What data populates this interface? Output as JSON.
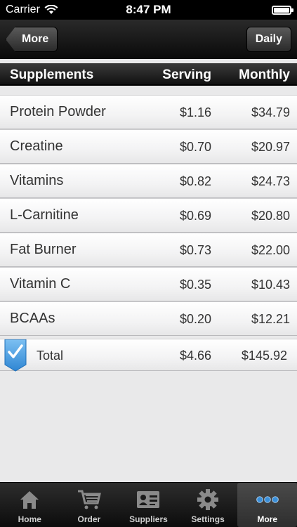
{
  "status_bar": {
    "carrier": "Carrier",
    "time": "8:47 PM"
  },
  "nav_bar": {
    "back_label": "More",
    "right_label": "Daily"
  },
  "table": {
    "headers": {
      "name": "Supplements",
      "serving": "Serving",
      "monthly": "Monthly"
    },
    "rows": [
      {
        "name": "Protein Powder",
        "serving": "$1.16",
        "monthly": "$34.79"
      },
      {
        "name": "Creatine",
        "serving": "$0.70",
        "monthly": "$20.97"
      },
      {
        "name": "Vitamins",
        "serving": "$0.82",
        "monthly": "$24.73"
      },
      {
        "name": "L-Carnitine",
        "serving": "$0.69",
        "monthly": "$20.80"
      },
      {
        "name": "Fat Burner",
        "serving": "$0.73",
        "monthly": "$22.00"
      },
      {
        "name": "Vitamin C",
        "serving": "$0.35",
        "monthly": "$10.43"
      },
      {
        "name": "BCAAs",
        "serving": "$0.20",
        "monthly": "$12.21"
      }
    ],
    "total": {
      "name": "Total",
      "serving": "$4.66",
      "monthly": "$145.92"
    }
  },
  "tab_bar": {
    "tabs": [
      {
        "label": "Home",
        "icon": "home-icon"
      },
      {
        "label": "Order",
        "icon": "cart-icon"
      },
      {
        "label": "Suppliers",
        "icon": "contact-card-icon"
      },
      {
        "label": "Settings",
        "icon": "gear-icon"
      },
      {
        "label": "More",
        "icon": "more-dots-icon"
      }
    ],
    "active_index": 4
  },
  "colors": {
    "accent_blue": "#3a8fd9",
    "background": "#e9e9ea"
  }
}
